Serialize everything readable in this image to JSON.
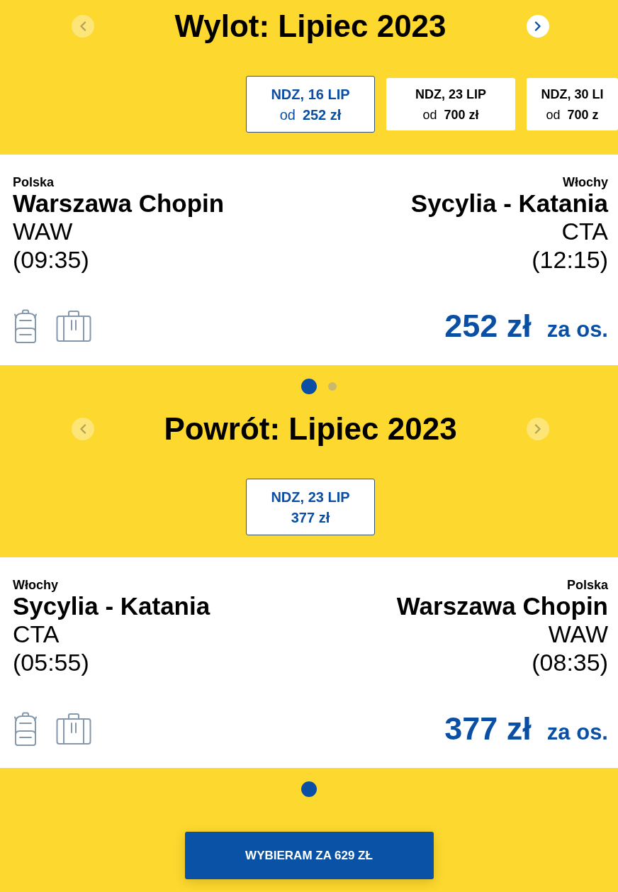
{
  "legs": [
    {
      "title": "Wylot: Lipiec 2023",
      "prev_button": {
        "disabled": true
      },
      "next_button": {
        "disabled": false
      },
      "dates": [
        {
          "day": "NDZ, 16 LIP",
          "prefix": "od",
          "price": "252 zł",
          "selected": true
        },
        {
          "day": "NDZ, 23 LIP",
          "prefix": "od",
          "price": "700 zł",
          "selected": false
        },
        {
          "day": "NDZ, 30 LI",
          "prefix": "od",
          "price": "700 z",
          "selected": false
        }
      ],
      "flight": {
        "origin": {
          "country": "Polska",
          "airport": "Warszawa Chopin",
          "code": "WAW",
          "time": "(09:35)"
        },
        "destination": {
          "country": "Włochy",
          "airport": "Sycylia - Katania",
          "code": "CTA",
          "time": "(12:15)"
        },
        "price": "252 zł",
        "price_unit": "za os."
      },
      "pages": [
        {
          "selected": true
        },
        {
          "selected": false
        }
      ]
    },
    {
      "title": "Powrót: Lipiec 2023",
      "prev_button": {
        "disabled": true
      },
      "next_button": {
        "disabled": true
      },
      "dates": [
        {
          "day": "NDZ, 23 LIP",
          "price": "377 zł",
          "selected": true
        }
      ],
      "flight": {
        "origin": {
          "country": "Włochy",
          "airport": "Sycylia - Katania",
          "code": "CTA",
          "time": "(05:55)"
        },
        "destination": {
          "country": "Polska",
          "airport": "Warszawa Chopin",
          "code": "WAW",
          "time": "(08:35)"
        },
        "price": "377 zł",
        "price_unit": "za os."
      },
      "pages": [
        {
          "selected": true
        }
      ]
    }
  ],
  "select_button": {
    "label": "WYBIERAM ZA 629 ZŁ"
  }
}
